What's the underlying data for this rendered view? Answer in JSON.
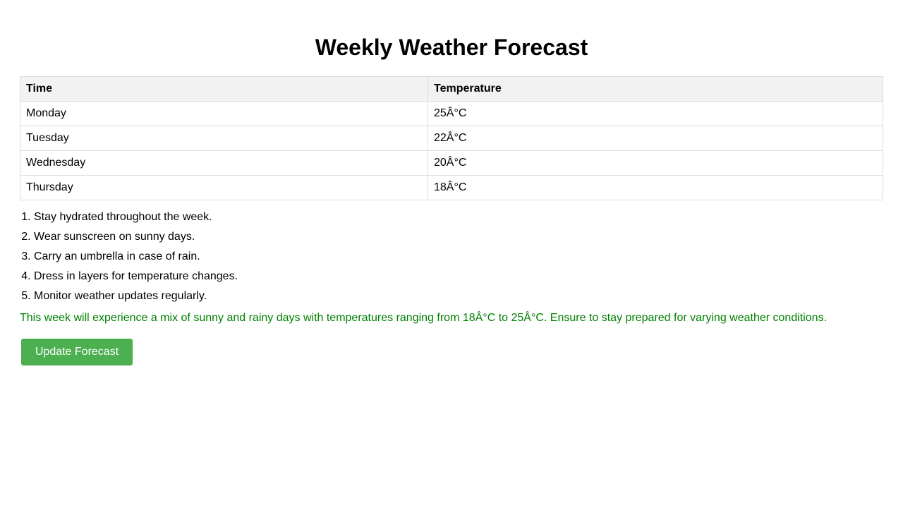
{
  "page": {
    "title": "Weekly Weather Forecast"
  },
  "table": {
    "headers": [
      "Time",
      "Temperature"
    ],
    "rows": [
      {
        "day": "Monday",
        "temperature": "25Â°C"
      },
      {
        "day": "Tuesday",
        "temperature": "22Â°C"
      },
      {
        "day": "Wednesday",
        "temperature": "20Â°C"
      },
      {
        "day": "Thursday",
        "temperature": "18Â°C"
      }
    ]
  },
  "tips": [
    "Stay hydrated throughout the week.",
    "Wear sunscreen on sunny days.",
    "Carry an umbrella in case of rain.",
    "Dress in layers for temperature changes.",
    "Monitor weather updates regularly."
  ],
  "summary": "This week will experience a mix of sunny and rainy days with temperatures ranging from 18Â°C to 25Â°C. Ensure to stay prepared for varying weather conditions.",
  "actions": {
    "update_label": "Update Forecast"
  },
  "colors": {
    "summary_text": "#008000",
    "button_background": "#4caf50",
    "header_background": "#f2f2f2"
  }
}
